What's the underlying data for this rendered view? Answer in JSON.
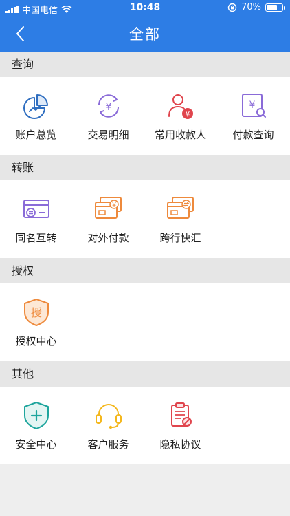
{
  "status_bar": {
    "carrier": "中国电信",
    "time": "10:48",
    "battery": "70%",
    "battery_level": 0.7
  },
  "header": {
    "title": "全部"
  },
  "sections": [
    {
      "title": "查询",
      "items": [
        {
          "label": "账户总览",
          "icon": "pie-chart-icon"
        },
        {
          "label": "交易明细",
          "icon": "yuan-cycle-icon"
        },
        {
          "label": "常用收款人",
          "icon": "payee-icon"
        },
        {
          "label": "付款查询",
          "icon": "payment-search-icon"
        }
      ]
    },
    {
      "title": "转账",
      "items": [
        {
          "label": "同名互转",
          "icon": "card-exchange-icon"
        },
        {
          "label": "对外付款",
          "icon": "card-yuan-icon"
        },
        {
          "label": "跨行快汇",
          "icon": "card-transfer-icon"
        }
      ]
    },
    {
      "title": "授权",
      "items": [
        {
          "label": "授权中心",
          "icon": "authorize-shield-icon",
          "badge": "授"
        }
      ]
    },
    {
      "title": "其他",
      "items": [
        {
          "label": "安全中心",
          "icon": "security-shield-icon"
        },
        {
          "label": "客户服务",
          "icon": "headset-icon"
        },
        {
          "label": "隐私协议",
          "icon": "clipboard-icon"
        }
      ]
    }
  ],
  "colors": {
    "header_bg": "#2d7de5",
    "blue": "#2f6ec0",
    "purple": "#8a6bd8",
    "red": "#e0454d",
    "orange": "#ee8a3c",
    "teal": "#1ea59d",
    "yellow": "#f4b71c"
  }
}
